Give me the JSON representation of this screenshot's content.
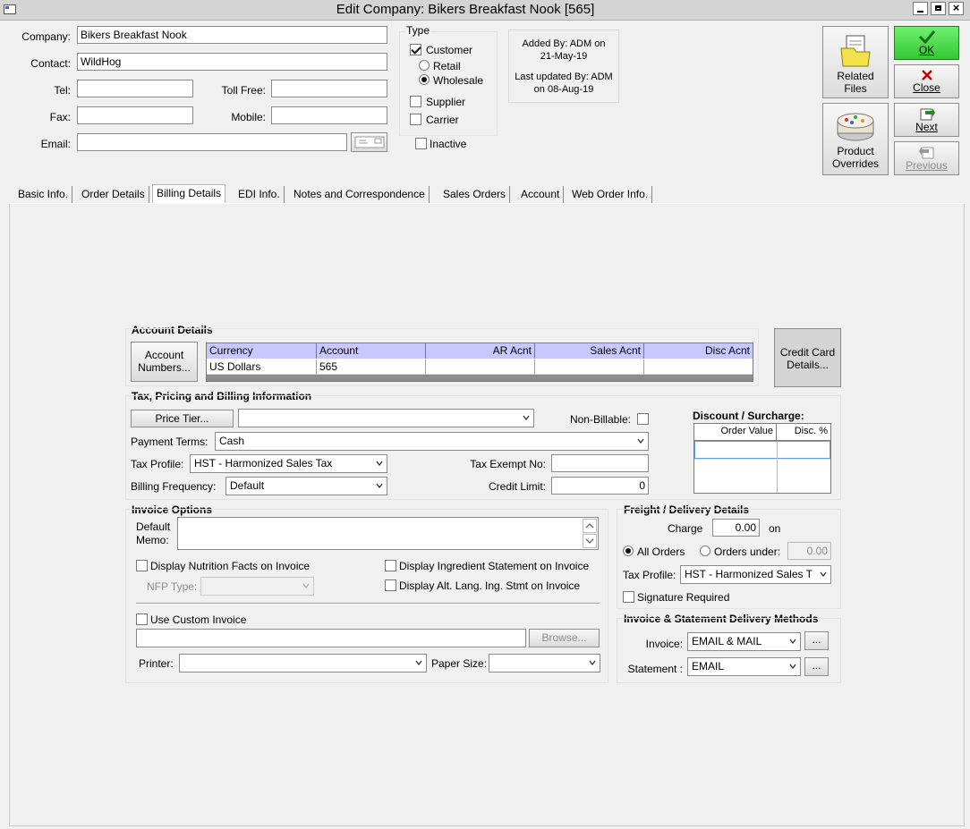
{
  "window": {
    "title": "Edit Company: Bikers Breakfast Nook [565]"
  },
  "company": {
    "company_label": "Company:",
    "company_value": "Bikers Breakfast Nook",
    "contact_label": "Contact:",
    "contact_value": "WildHog",
    "tel_label": "Tel:",
    "tel_value": "",
    "tollfree_label": "Toll Free:",
    "tollfree_value": "",
    "fax_label": "Fax:",
    "fax_value": "",
    "mobile_label": "Mobile:",
    "mobile_value": "",
    "email_label": "Email:",
    "email_value": ""
  },
  "type": {
    "title": "Type",
    "customer": "Customer",
    "retail": "Retail",
    "wholesale": "Wholesale",
    "supplier": "Supplier",
    "carrier": "Carrier",
    "inactive": "Inactive"
  },
  "audit": {
    "added_by": "Added By: ADM on",
    "added_date": "21-May-19",
    "updated_by": "Last updated By: ADM",
    "updated_date": "on 08-Aug-19"
  },
  "actions": {
    "related_1": "Related",
    "related_2": "Files",
    "product_1": "Product",
    "product_2": "Overrides",
    "ok": "OK",
    "close": "Close",
    "next": "Next",
    "previous": "Previous"
  },
  "tabs": [
    "Basic Info.",
    "Order Details",
    "Billing Details",
    "EDI Info.",
    "Notes and Correspondence",
    "Sales Orders",
    "Account",
    "Web Order Info."
  ],
  "account": {
    "title": "Account Details",
    "numbers_1": "Account",
    "numbers_2": "Numbers...",
    "columns": [
      "Currency",
      "Account",
      "AR Acnt",
      "Sales Acnt",
      "Disc Acnt"
    ],
    "rows": [
      [
        "US Dollars",
        "565",
        "",
        "",
        ""
      ]
    ],
    "cc_1": "Credit Card",
    "cc_2": "Details..."
  },
  "tax": {
    "title": "Tax, Pricing and Billing Information",
    "price_tier": "Price Tier...",
    "price_tier_value": "",
    "non_billable": "Non-Billable:",
    "payment_terms_label": "Payment Terms:",
    "payment_terms_value": "Cash",
    "tax_profile_label": "Tax Profile:",
    "tax_profile_value": "HST - Harmonized Sales Tax",
    "tax_exempt_label": "Tax Exempt No:",
    "tax_exempt_value": "",
    "billing_freq_label": "Billing Frequency:",
    "billing_freq_value": "Default",
    "credit_limit_label": "Credit Limit:",
    "credit_limit_value": "0"
  },
  "discount": {
    "title": "Discount / Surcharge:",
    "columns": [
      "Order Value",
      "Disc. %"
    ]
  },
  "invoice": {
    "title": "Invoice Options",
    "memo_1": "Default",
    "memo_2": "Memo:",
    "nutrition": "Display Nutrition Facts on Invoice",
    "nfp_label": "NFP Type:",
    "ingredient": "Display Ingredient Statement on Invoice",
    "alt_lang": "Display Alt. Lang. Ing. Stmt on Invoice",
    "custom": "Use Custom Invoice",
    "browse": "Browse...",
    "printer_label": "Printer:",
    "paper_label": "Paper Size:"
  },
  "freight": {
    "title": "Freight / Delivery Details",
    "charge_label": "Charge",
    "charge_value": "0.00",
    "on": "on",
    "all_orders": "All Orders",
    "orders_under": "Orders under:",
    "under_value": "0.00",
    "tax_label": "Tax Profile:",
    "tax_value": "HST - Harmonized Sales T",
    "signature": "Signature Required"
  },
  "delivery": {
    "title": "Invoice & Statement Delivery Methods",
    "invoice_label": "Invoice:",
    "invoice_value": "EMAIL & MAIL",
    "statement_label": "Statement :",
    "statement_value": "EMAIL",
    "ellipsis": "..."
  }
}
